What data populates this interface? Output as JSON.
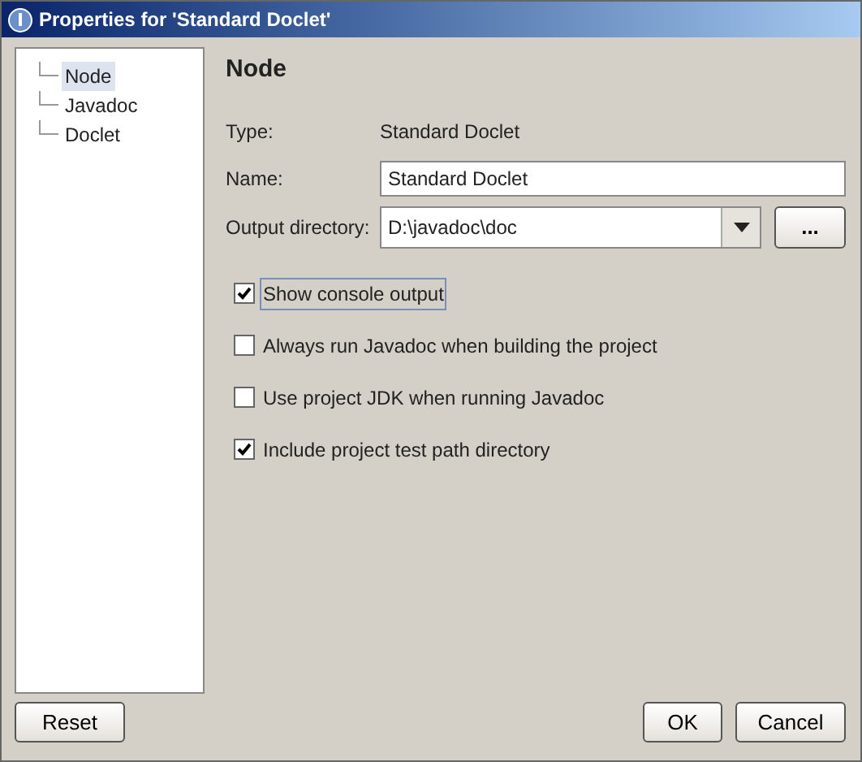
{
  "window": {
    "title": "Properties for 'Standard Doclet'"
  },
  "tree": [
    {
      "label": "Node",
      "selected": true
    },
    {
      "label": "Javadoc",
      "selected": false
    },
    {
      "label": "Doclet",
      "selected": false
    }
  ],
  "heading": "Node",
  "type": {
    "label": "Type:",
    "value": "Standard Doclet"
  },
  "name": {
    "label": "Name:",
    "value": "Standard Doclet"
  },
  "output": {
    "label": "Output directory:",
    "value": "D:\\javadoc\\doc",
    "browse": "..."
  },
  "options": [
    {
      "label": "Show console output",
      "checked": true,
      "focused": true
    },
    {
      "label": "Always run Javadoc when building the project",
      "checked": false,
      "focused": false
    },
    {
      "label": "Use project JDK when running Javadoc",
      "checked": false,
      "focused": false
    },
    {
      "label": "Include project test path directory",
      "checked": true,
      "focused": false
    }
  ],
  "buttons": {
    "reset": "Reset",
    "ok": "OK",
    "cancel": "Cancel"
  }
}
